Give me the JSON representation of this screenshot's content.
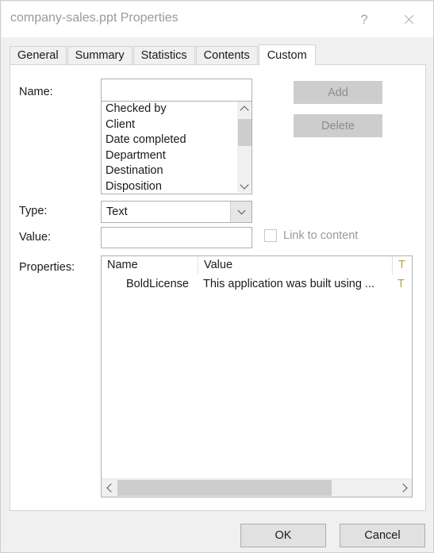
{
  "window": {
    "title": "company-sales.ppt Properties",
    "help_icon": "question-mark-icon",
    "close_icon": "close-icon"
  },
  "tabs": [
    {
      "label": "General",
      "active": false
    },
    {
      "label": "Summary",
      "active": false
    },
    {
      "label": "Statistics",
      "active": false
    },
    {
      "label": "Contents",
      "active": false
    },
    {
      "label": "Custom",
      "active": true
    }
  ],
  "form": {
    "name_label": "Name:",
    "name_value": "",
    "type_label": "Type:",
    "type_value": "Text",
    "value_label": "Value:",
    "value_value": "",
    "properties_label": "Properties:",
    "link_to_content_label": "Link to content",
    "link_to_content_checked": false
  },
  "name_suggestions": [
    "Checked by",
    "Client",
    "Date completed",
    "Department",
    "Destination",
    "Disposition"
  ],
  "buttons": {
    "add": "Add",
    "delete": "Delete",
    "ok": "OK",
    "cancel": "Cancel"
  },
  "properties_table": {
    "columns": [
      "Name",
      "Value",
      "T"
    ],
    "rows": [
      {
        "name": "BoldLicense",
        "value": "This application was built using ...",
        "type": "T"
      }
    ]
  },
  "colors": {
    "dialog_background": "#f0f0f0",
    "panel_background": "#ffffff",
    "title_text": "#9a9a9a",
    "disabled_text": "#8d8d8d",
    "border": "#b0b0b0",
    "scroll_thumb": "#cdcdcd"
  }
}
